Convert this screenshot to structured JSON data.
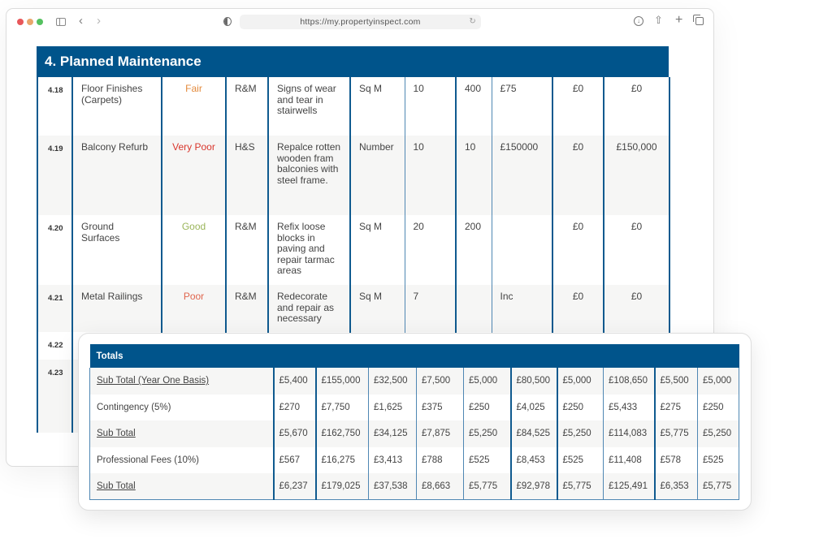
{
  "browser": {
    "url": "https://my.propertyinspect.com",
    "icons": [
      "close-dot",
      "minimize-dot",
      "zoom-dot",
      "sidebar-icon",
      "back-icon",
      "forward-icon",
      "shield-icon",
      "reload-icon",
      "download-icon",
      "share-icon",
      "new-tab-icon",
      "tabs-icon"
    ]
  },
  "section": {
    "title": "4. Planned Maintenance"
  },
  "condition_colors": {
    "Good": "#9ab55a",
    "Fair": "#e38a3c",
    "Poor": "#e0664e",
    "Very Poor": "#d9362c"
  },
  "rows": [
    {
      "ref": "4.18",
      "element": "Floor Finishes (Carpets)",
      "condition": "Fair",
      "category": "R&M",
      "action": "Signs of wear and tear in stairwells",
      "unit": "Sq M",
      "life": "10",
      "qty": "400",
      "rate": "£75",
      "cost1": "£0",
      "cost2": "£0"
    },
    {
      "ref": "4.19",
      "element": "Balcony Refurb",
      "condition": "Very Poor",
      "category": "H&S",
      "action": "Repalce rotten wooden fram balconies with steel frame.",
      "unit": "Number",
      "life": "10",
      "qty": "10",
      "rate": "£150000",
      "cost1": "£0",
      "cost2": "£150,000"
    },
    {
      "ref": "4.20",
      "element": "Ground Surfaces",
      "condition": "Good",
      "category": "R&M",
      "action": "Refix loose blocks in paving and repair tarmac areas",
      "unit": "Sq M",
      "life": "20",
      "qty": "200",
      "rate": "",
      "cost1": "£0",
      "cost2": "£0"
    },
    {
      "ref": "4.21",
      "element": "Metal Railings",
      "condition": "Poor",
      "category": "R&M",
      "action": "Redecorate and repair as necessary",
      "unit": "Sq M",
      "life": "7",
      "qty": "",
      "rate": "Inc",
      "cost1": "£0",
      "cost2": "£0"
    },
    {
      "ref": "4.22",
      "element": "",
      "condition": "",
      "category": "",
      "action": "",
      "unit": "",
      "life": "",
      "qty": "",
      "rate": "",
      "cost1": "",
      "cost2": ""
    },
    {
      "ref": "4.23",
      "element": "",
      "condition": "",
      "category": "",
      "action": "",
      "unit": "",
      "life": "",
      "qty": "",
      "rate": "",
      "cost1": "",
      "cost2": ""
    }
  ],
  "totals": {
    "title": "Totals",
    "rows": [
      {
        "label": "Sub Total (Year One Basis)",
        "link": true,
        "values": [
          "£5,400",
          "£155,000",
          "£32,500",
          "£7,500",
          "£5,000",
          "£80,500",
          "£5,000",
          "£108,650",
          "£5,500",
          "£5,000"
        ]
      },
      {
        "label": "Contingency (5%)",
        "link": false,
        "values": [
          "£270",
          "£7,750",
          "£1,625",
          "£375",
          "£250",
          "£4,025",
          "£250",
          "£5,433",
          "£275",
          "£250"
        ]
      },
      {
        "label": "Sub Total",
        "link": true,
        "values": [
          "£5,670",
          "£162,750",
          "£34,125",
          "£7,875",
          "£5,250",
          "£84,525",
          "£5,250",
          "£114,083",
          "£5,775",
          "£5,250"
        ]
      },
      {
        "label": "Professional Fees (10%)",
        "link": false,
        "values": [
          "£567",
          "£16,275",
          "£3,413",
          "£788",
          "£525",
          "£8,453",
          "£525",
          "£11,408",
          "£578",
          "£525"
        ]
      },
      {
        "label": "Sub Total",
        "link": true,
        "values": [
          "£6,237",
          "£179,025",
          "£37,538",
          "£8,663",
          "£5,775",
          "£92,978",
          "£5,775",
          "£125,491",
          "£6,353",
          "£5,775"
        ]
      }
    ]
  }
}
